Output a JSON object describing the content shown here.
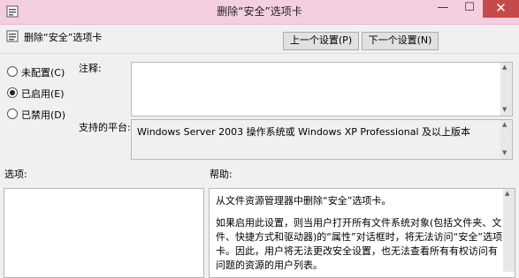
{
  "window": {
    "title": "删除“安全”选项卡",
    "min": "—",
    "max": "☐",
    "close": "✕"
  },
  "header": {
    "title": "删除“安全”选项卡",
    "prev_label": "上一个设置(P)",
    "next_label": "下一个设置(N)"
  },
  "state": {
    "options": [
      {
        "label": "未配置(C)",
        "selected": false
      },
      {
        "label": "已启用(E)",
        "selected": true
      },
      {
        "label": "已禁用(D)",
        "selected": false
      }
    ]
  },
  "comment": {
    "label": "注释:",
    "value": ""
  },
  "platform": {
    "label": "支持的平台:",
    "value": "Windows Server 2003 操作系统或 Windows XP Professional 及以上版本"
  },
  "options_section": {
    "label": "选项:"
  },
  "help": {
    "label": "帮助:",
    "p1": "从文件资源管理器中删除“安全”选项卡。",
    "p2": "如果启用此设置，则当用户打开所有文件系统对象(包括文件夹、文件、快捷方式和驱动器)的“属性”对话框时，将无法访问“安全”选项卡。因此，用户将无法更改安全设置，也无法查看所有有权访问有问题的资源的用户列表。"
  }
}
